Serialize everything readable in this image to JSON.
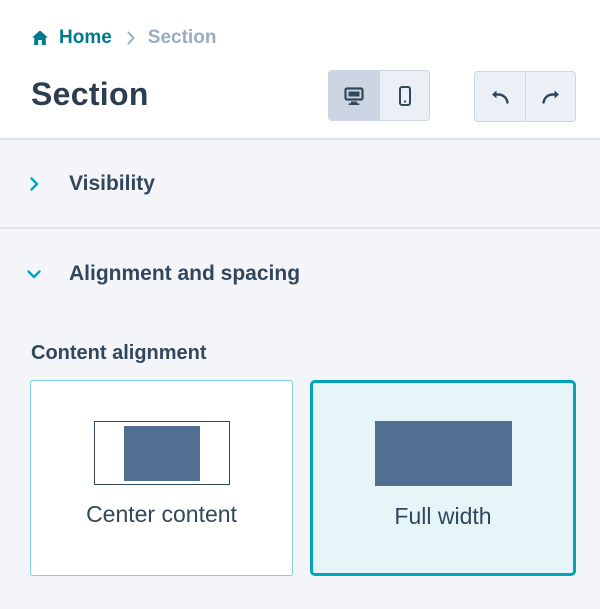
{
  "breadcrumb": {
    "home_label": "Home",
    "current_label": "Section"
  },
  "page_title": "Section",
  "device_toggle": {
    "options": [
      "desktop",
      "mobile"
    ],
    "selected": "desktop"
  },
  "history": {
    "undo_icon": "undo-icon",
    "redo_icon": "redo-icon"
  },
  "sections": {
    "visibility": {
      "label": "Visibility",
      "expanded": false
    },
    "alignment": {
      "label": "Alignment and spacing",
      "expanded": true
    }
  },
  "content_alignment": {
    "label": "Content alignment",
    "options": [
      {
        "label": "Center content",
        "selected": false
      },
      {
        "label": "Full width",
        "selected": true
      }
    ]
  },
  "colors": {
    "accent": "#00a4bd",
    "link": "#007a8c",
    "text": "#33475b",
    "block": "#516f90",
    "panel_bg": "#f3f5f9"
  }
}
